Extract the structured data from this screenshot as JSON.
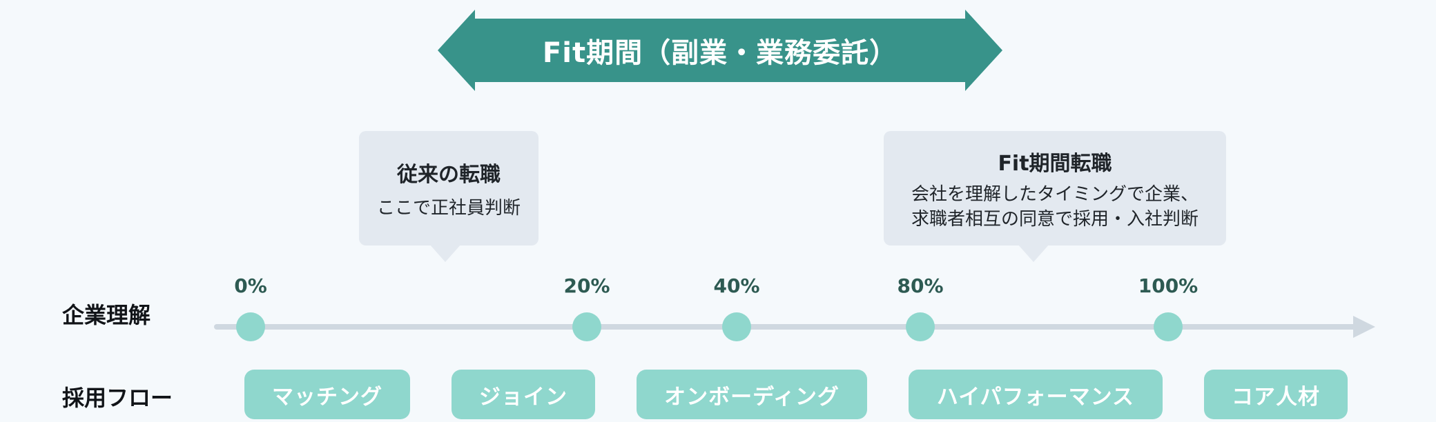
{
  "banner": {
    "title": "Fit期間（副業・業務委託）",
    "color": "#38938a"
  },
  "callouts": {
    "traditional": {
      "title": "従来の転職",
      "body": [
        "ここで正社員判断"
      ]
    },
    "fit": {
      "title": "Fit期間転職",
      "body": [
        "会社を理解したタイミングで企業、",
        "求職者相互の同意で採用・入社判断"
      ]
    },
    "fill": "#e3e9f0"
  },
  "rows": {
    "understanding": "企業理解",
    "flow": "採用フロー"
  },
  "milestones": [
    {
      "label": "0%",
      "value": 0
    },
    {
      "label": "20%",
      "value": 20
    },
    {
      "label": "40%",
      "value": 40
    },
    {
      "label": "80%",
      "value": 80
    },
    {
      "label": "100%",
      "value": 100
    }
  ],
  "flow_steps": [
    "マッチング",
    "ジョイン",
    "オンボーディング",
    "ハイパフォーマンス",
    "コア人材"
  ],
  "colors": {
    "accent_light": "#8fd7cd",
    "axis": "#cfd8e0",
    "percent_text": "#2d5a52"
  }
}
